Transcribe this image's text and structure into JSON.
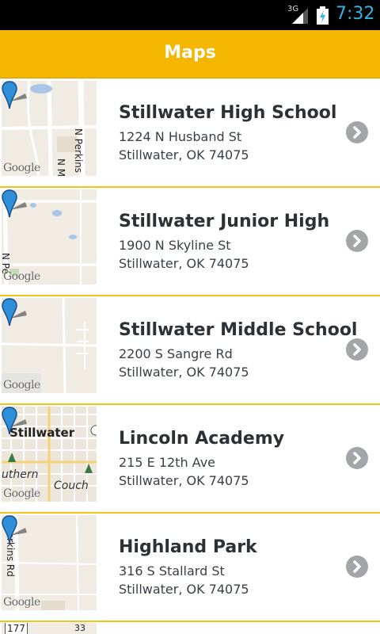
{
  "status_bar": {
    "network": "3G",
    "time": "7:32"
  },
  "header": {
    "title": "Maps"
  },
  "map_watermark": "Google",
  "items": [
    {
      "name": "Stillwater High School",
      "address_line1": "1224 N Husband St",
      "address_line2": "Stillwater, OK 74075",
      "map_labels": [
        "N Perkins R",
        "N M"
      ]
    },
    {
      "name": "Stillwater Junior High",
      "address_line1": "1900 N Skyline St",
      "address_line2": "Stillwater, OK 74075",
      "map_labels": [
        "N Pe"
      ]
    },
    {
      "name": "Stillwater Middle School",
      "address_line1": "2200 S Sangre Rd",
      "address_line2": "Stillwater, OK 74075",
      "map_labels": []
    },
    {
      "name": "Lincoln Academy",
      "address_line1": "215 E 12th Ave",
      "address_line2": "Stillwater, OK 74075",
      "map_labels": [
        "Stillwater",
        "uthern",
        "Couch"
      ]
    },
    {
      "name": "Highland Park",
      "address_line1": "316 S Stallard St",
      "address_line2": "Stillwater, OK 74075",
      "map_labels": [
        "N Perkins Rd"
      ]
    }
  ],
  "partial_row": {
    "map_labels": [
      "177",
      "33"
    ]
  },
  "colors": {
    "accent": "#f5b600",
    "status_clock": "#33b5e5",
    "chevron": "#a3a5a8",
    "pin": "#2f8fd8"
  },
  "icons": {
    "row_action": "chevron-right-circle-icon",
    "map_marker": "map-pin-icon"
  }
}
